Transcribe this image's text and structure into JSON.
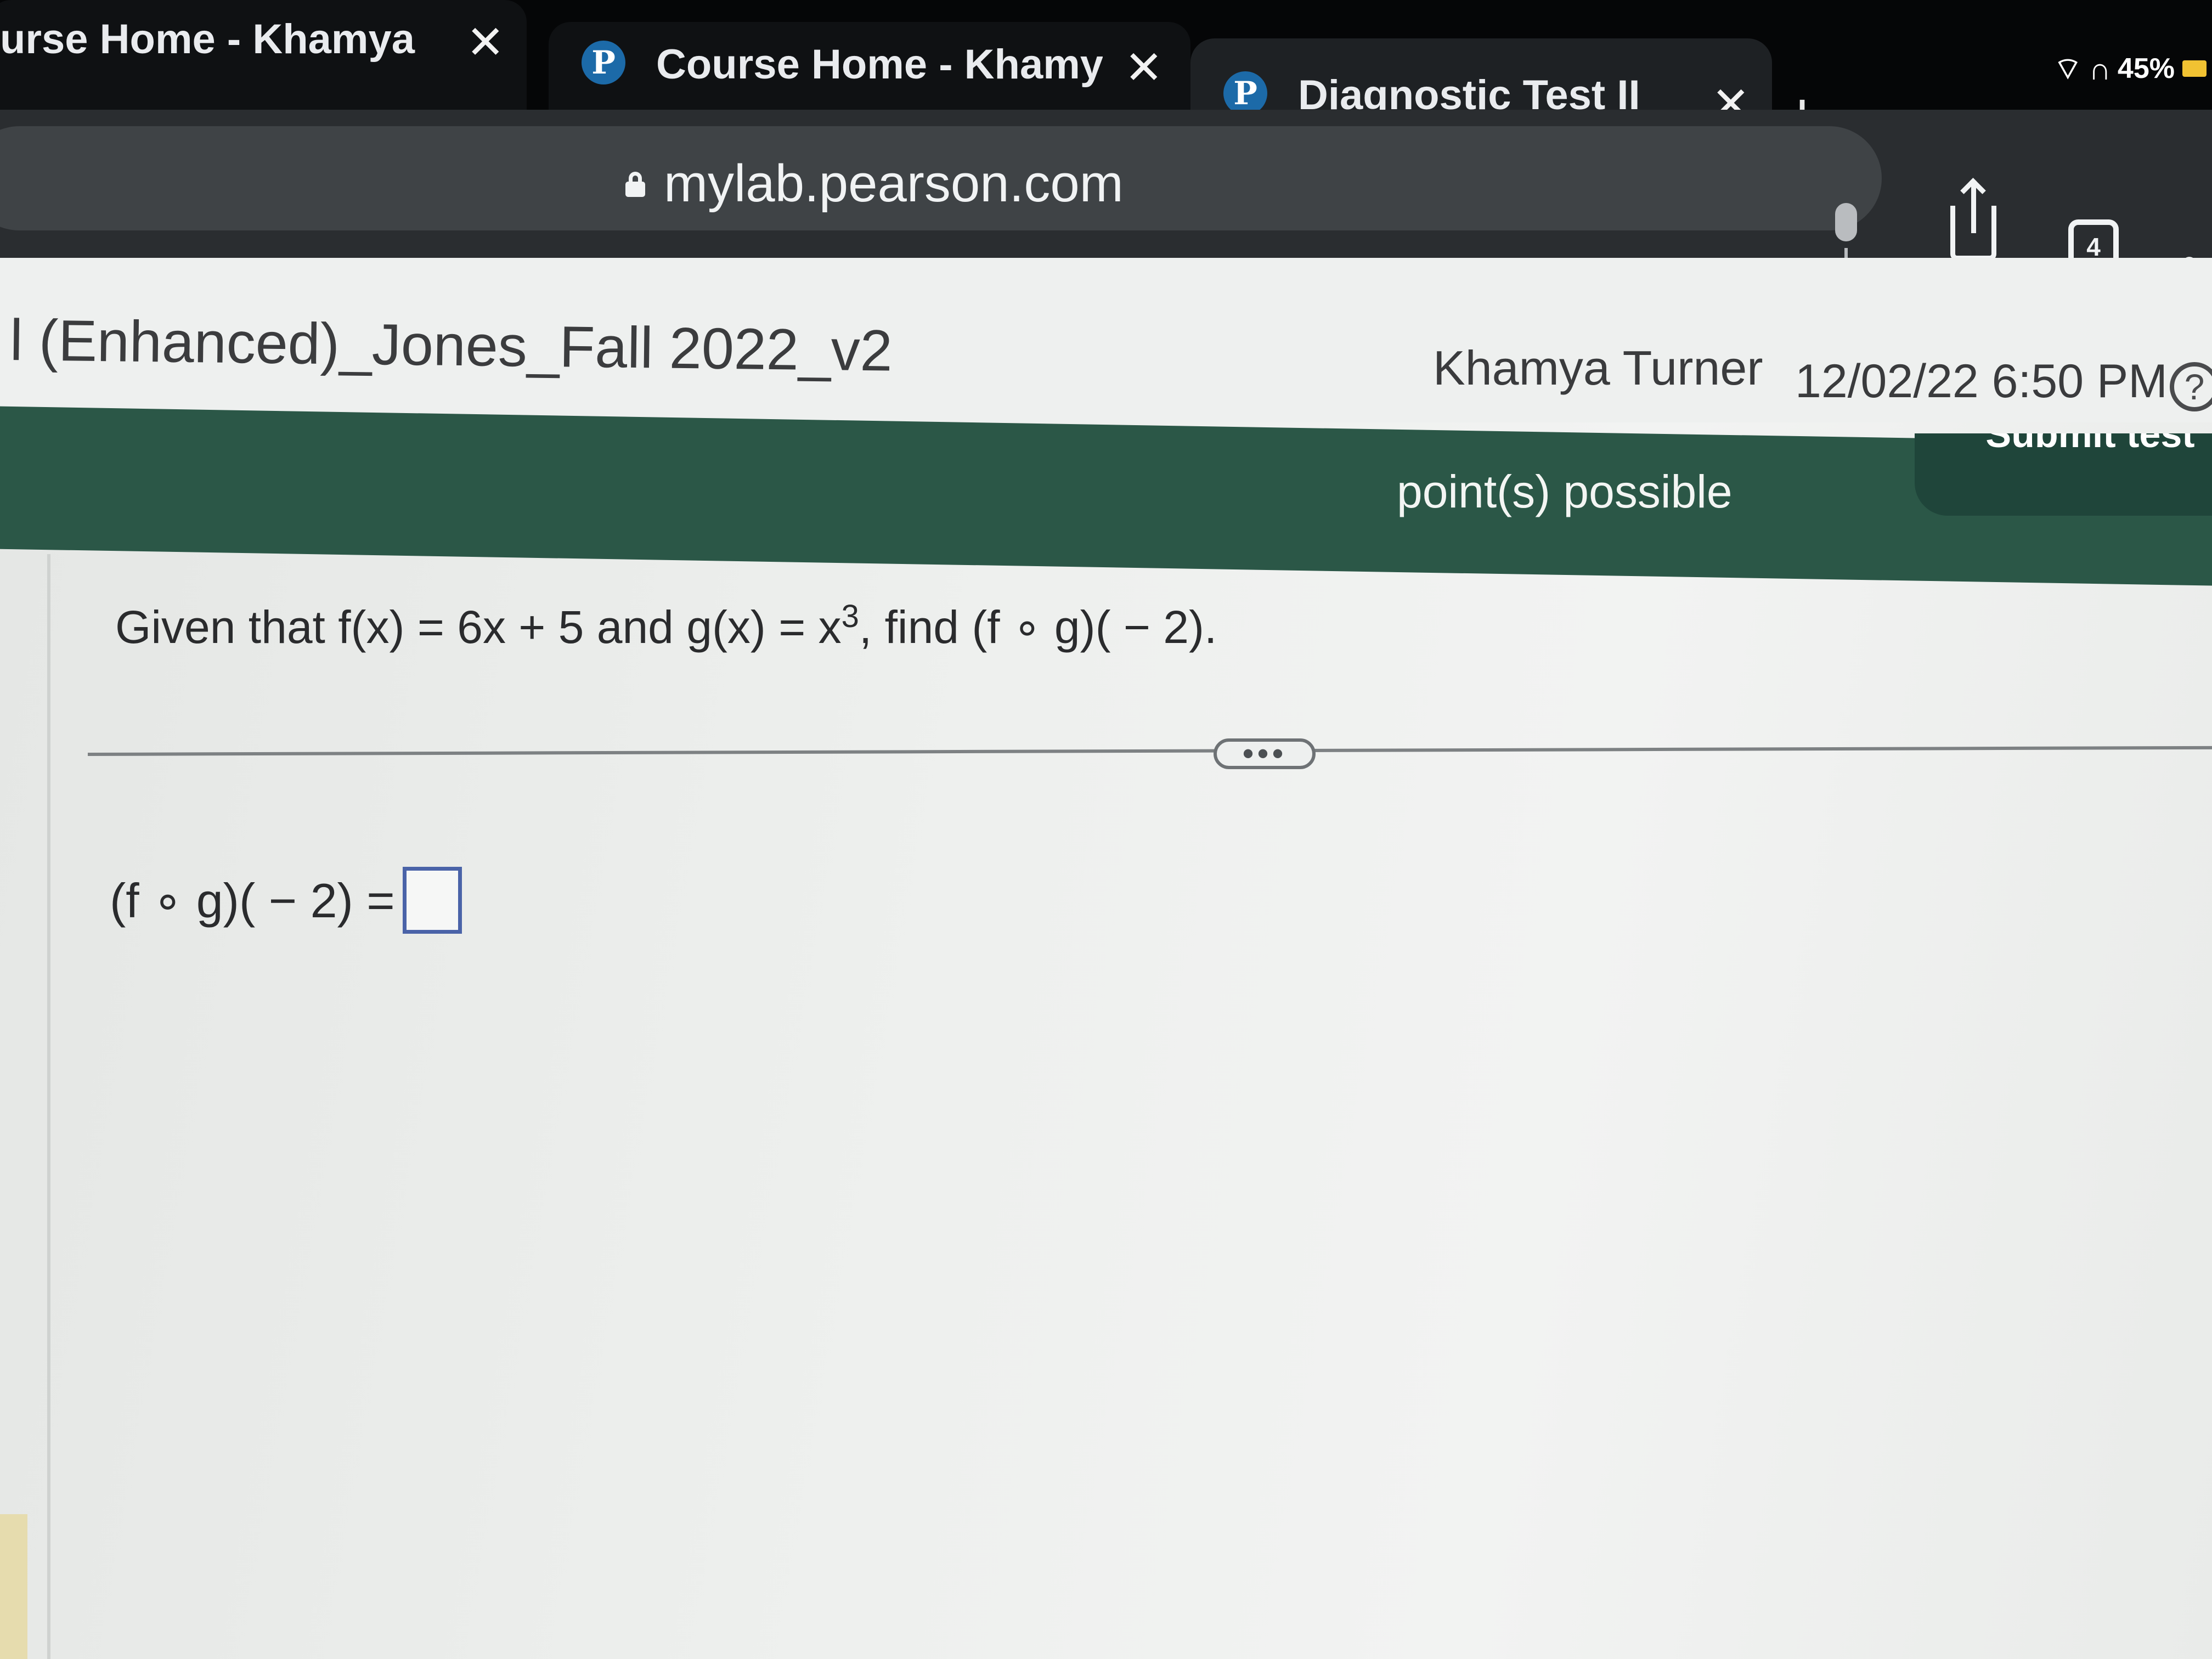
{
  "tabs": [
    {
      "title": "urse Home - Khamya",
      "favicon": "",
      "close": "✕",
      "state": "inactive"
    },
    {
      "title": "Course Home - Khamya",
      "favicon": "P",
      "close": "✕",
      "state": "inactive"
    },
    {
      "title": "Diagnostic Test II",
      "favicon": "P",
      "close": "✕",
      "state": "active"
    }
  ],
  "new_tab": "+",
  "status": {
    "battery": "45%",
    "wifi_icon": "wifi-icon",
    "headphones_icon": "headphones-icon",
    "battery_color": "#f1c232"
  },
  "address": {
    "url": "mylab.pearson.com"
  },
  "toolbar": {
    "tab_count": "4",
    "more": "•"
  },
  "header": {
    "course_title": "l (Enhanced)_Jones_Fall 2022_v2",
    "user": "Khamya Turner",
    "timestamp": "12/02/22 6:50 PM",
    "help": "?"
  },
  "status_bar": {
    "points": "point(s) possible",
    "submit_label": "Submit test",
    "color": "#2b5747"
  },
  "question": {
    "prefix": "Given that f(x) = 6x + 5 and g(x) = x",
    "exponent": "3",
    "suffix": ", find (f ∘ g)( − 2)."
  },
  "divider_handle": "•••",
  "answer": {
    "label": "(f ∘ g)( − 2) =",
    "value": ""
  }
}
